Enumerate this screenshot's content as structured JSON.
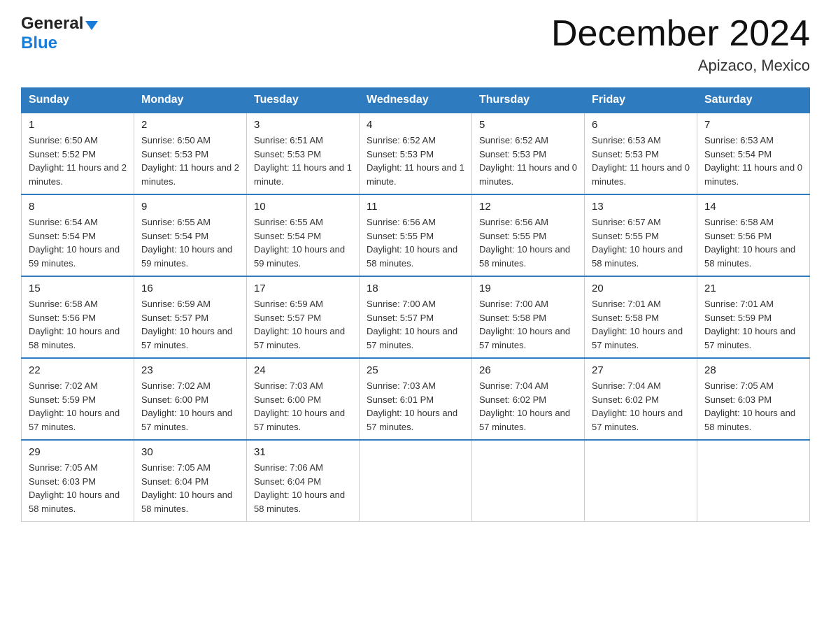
{
  "header": {
    "logo_general": "General",
    "logo_blue": "Blue",
    "month_title": "December 2024",
    "location": "Apizaco, Mexico"
  },
  "days_of_week": [
    "Sunday",
    "Monday",
    "Tuesday",
    "Wednesday",
    "Thursday",
    "Friday",
    "Saturday"
  ],
  "weeks": [
    [
      {
        "num": "1",
        "sunrise": "6:50 AM",
        "sunset": "5:52 PM",
        "daylight": "11 hours and 2 minutes."
      },
      {
        "num": "2",
        "sunrise": "6:50 AM",
        "sunset": "5:53 PM",
        "daylight": "11 hours and 2 minutes."
      },
      {
        "num": "3",
        "sunrise": "6:51 AM",
        "sunset": "5:53 PM",
        "daylight": "11 hours and 1 minute."
      },
      {
        "num": "4",
        "sunrise": "6:52 AM",
        "sunset": "5:53 PM",
        "daylight": "11 hours and 1 minute."
      },
      {
        "num": "5",
        "sunrise": "6:52 AM",
        "sunset": "5:53 PM",
        "daylight": "11 hours and 0 minutes."
      },
      {
        "num": "6",
        "sunrise": "6:53 AM",
        "sunset": "5:53 PM",
        "daylight": "11 hours and 0 minutes."
      },
      {
        "num": "7",
        "sunrise": "6:53 AM",
        "sunset": "5:54 PM",
        "daylight": "11 hours and 0 minutes."
      }
    ],
    [
      {
        "num": "8",
        "sunrise": "6:54 AM",
        "sunset": "5:54 PM",
        "daylight": "10 hours and 59 minutes."
      },
      {
        "num": "9",
        "sunrise": "6:55 AM",
        "sunset": "5:54 PM",
        "daylight": "10 hours and 59 minutes."
      },
      {
        "num": "10",
        "sunrise": "6:55 AM",
        "sunset": "5:54 PM",
        "daylight": "10 hours and 59 minutes."
      },
      {
        "num": "11",
        "sunrise": "6:56 AM",
        "sunset": "5:55 PM",
        "daylight": "10 hours and 58 minutes."
      },
      {
        "num": "12",
        "sunrise": "6:56 AM",
        "sunset": "5:55 PM",
        "daylight": "10 hours and 58 minutes."
      },
      {
        "num": "13",
        "sunrise": "6:57 AM",
        "sunset": "5:55 PM",
        "daylight": "10 hours and 58 minutes."
      },
      {
        "num": "14",
        "sunrise": "6:58 AM",
        "sunset": "5:56 PM",
        "daylight": "10 hours and 58 minutes."
      }
    ],
    [
      {
        "num": "15",
        "sunrise": "6:58 AM",
        "sunset": "5:56 PM",
        "daylight": "10 hours and 58 minutes."
      },
      {
        "num": "16",
        "sunrise": "6:59 AM",
        "sunset": "5:57 PM",
        "daylight": "10 hours and 57 minutes."
      },
      {
        "num": "17",
        "sunrise": "6:59 AM",
        "sunset": "5:57 PM",
        "daylight": "10 hours and 57 minutes."
      },
      {
        "num": "18",
        "sunrise": "7:00 AM",
        "sunset": "5:57 PM",
        "daylight": "10 hours and 57 minutes."
      },
      {
        "num": "19",
        "sunrise": "7:00 AM",
        "sunset": "5:58 PM",
        "daylight": "10 hours and 57 minutes."
      },
      {
        "num": "20",
        "sunrise": "7:01 AM",
        "sunset": "5:58 PM",
        "daylight": "10 hours and 57 minutes."
      },
      {
        "num": "21",
        "sunrise": "7:01 AM",
        "sunset": "5:59 PM",
        "daylight": "10 hours and 57 minutes."
      }
    ],
    [
      {
        "num": "22",
        "sunrise": "7:02 AM",
        "sunset": "5:59 PM",
        "daylight": "10 hours and 57 minutes."
      },
      {
        "num": "23",
        "sunrise": "7:02 AM",
        "sunset": "6:00 PM",
        "daylight": "10 hours and 57 minutes."
      },
      {
        "num": "24",
        "sunrise": "7:03 AM",
        "sunset": "6:00 PM",
        "daylight": "10 hours and 57 minutes."
      },
      {
        "num": "25",
        "sunrise": "7:03 AM",
        "sunset": "6:01 PM",
        "daylight": "10 hours and 57 minutes."
      },
      {
        "num": "26",
        "sunrise": "7:04 AM",
        "sunset": "6:02 PM",
        "daylight": "10 hours and 57 minutes."
      },
      {
        "num": "27",
        "sunrise": "7:04 AM",
        "sunset": "6:02 PM",
        "daylight": "10 hours and 57 minutes."
      },
      {
        "num": "28",
        "sunrise": "7:05 AM",
        "sunset": "6:03 PM",
        "daylight": "10 hours and 58 minutes."
      }
    ],
    [
      {
        "num": "29",
        "sunrise": "7:05 AM",
        "sunset": "6:03 PM",
        "daylight": "10 hours and 58 minutes."
      },
      {
        "num": "30",
        "sunrise": "7:05 AM",
        "sunset": "6:04 PM",
        "daylight": "10 hours and 58 minutes."
      },
      {
        "num": "31",
        "sunrise": "7:06 AM",
        "sunset": "6:04 PM",
        "daylight": "10 hours and 58 minutes."
      },
      null,
      null,
      null,
      null
    ]
  ]
}
